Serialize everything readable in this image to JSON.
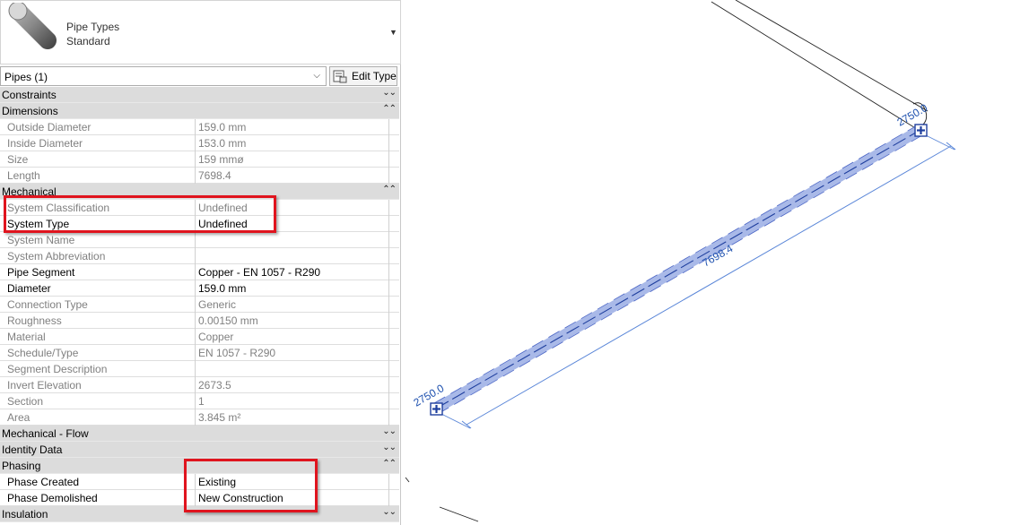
{
  "type_selector": {
    "family": "Pipe Types",
    "type": "Standard"
  },
  "instance_filter": {
    "value": "Pipes (1)",
    "edit_type_label": "Edit Type"
  },
  "categories": {
    "constraints": "Constraints",
    "dimensions": "Dimensions",
    "mechanical": "Mechanical",
    "mechanical_flow": "Mechanical - Flow",
    "identity_data": "Identity Data",
    "phasing": "Phasing",
    "insulation": "Insulation"
  },
  "dimensions": [
    {
      "name": "Outside Diameter",
      "value": "159.0 mm"
    },
    {
      "name": "Inside Diameter",
      "value": "153.0 mm"
    },
    {
      "name": "Size",
      "value": "159 mmø"
    },
    {
      "name": "Length",
      "value": "7698.4"
    }
  ],
  "mechanical": [
    {
      "name": "System Classification",
      "value": "Undefined"
    },
    {
      "name": "System Type",
      "value": "Undefined"
    },
    {
      "name": "System Name",
      "value": ""
    },
    {
      "name": "System Abbreviation",
      "value": ""
    },
    {
      "name": "Pipe Segment",
      "value": "Copper - EN 1057 - R290"
    },
    {
      "name": "Diameter",
      "value": "159.0 mm"
    },
    {
      "name": "Connection Type",
      "value": "Generic"
    },
    {
      "name": "Roughness",
      "value": "0.00150 mm"
    },
    {
      "name": "Material",
      "value": "Copper"
    },
    {
      "name": "Schedule/Type",
      "value": "EN 1057 - R290"
    },
    {
      "name": "Segment Description",
      "value": ""
    },
    {
      "name": "Invert Elevation",
      "value": "2673.5"
    },
    {
      "name": "Section",
      "value": "1"
    },
    {
      "name": "Area",
      "value": "3.845 m²"
    }
  ],
  "phasing": [
    {
      "name": "Phase Created",
      "value": "Existing"
    },
    {
      "name": "Phase Demolished",
      "value": "New Construction"
    }
  ],
  "viewport": {
    "length_dimension": "7698.4",
    "start_elevation": "2750.0",
    "end_elevation": "2750.0"
  },
  "colors": {
    "pipe_fill": "#a9b9e8",
    "pipe_centerline": "#1f3f9e",
    "dimension_line": "#5a86d8",
    "dimension_text": "#1c4fae",
    "highlight_box": "#e0141e"
  }
}
